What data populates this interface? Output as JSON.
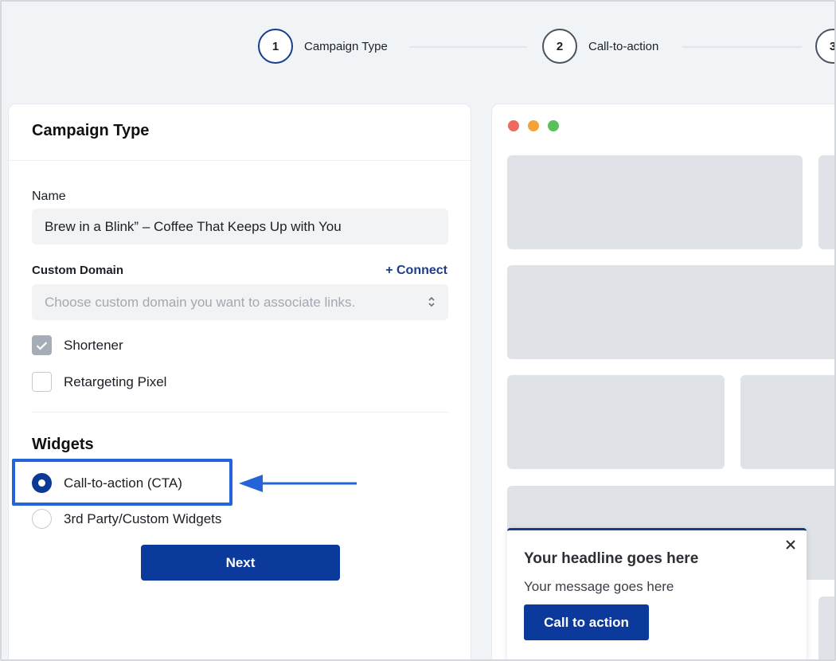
{
  "stepper": {
    "steps": [
      {
        "number": "1",
        "label": "Campaign Type"
      },
      {
        "number": "2",
        "label": "Call-to-action"
      },
      {
        "number": "3",
        "label": ""
      }
    ]
  },
  "form": {
    "title": "Campaign Type",
    "name_label": "Name",
    "name_value": "Brew in a Blink” – Coffee That Keeps Up with You",
    "domain_label": "Custom Domain",
    "connect_label": "+ Connect",
    "domain_placeholder": "Choose custom domain you want to associate links.",
    "shortener_label": "Shortener",
    "retargeting_label": "Retargeting Pixel",
    "widgets_title": "Widgets",
    "cta_option_label": "Call-to-action (CTA)",
    "third_party_label": "3rd Party/Custom Widgets",
    "next_label": "Next"
  },
  "preview": {
    "window_dots": [
      "#ec6a5e",
      "#f4a33a",
      "#5ac05a"
    ],
    "cta_popup": {
      "headline": "Your headline goes here",
      "message": "Your message goes here",
      "button_label": "Call to action"
    }
  },
  "colors": {
    "accent": "#0b3a9c",
    "highlight": "#2563d9"
  }
}
